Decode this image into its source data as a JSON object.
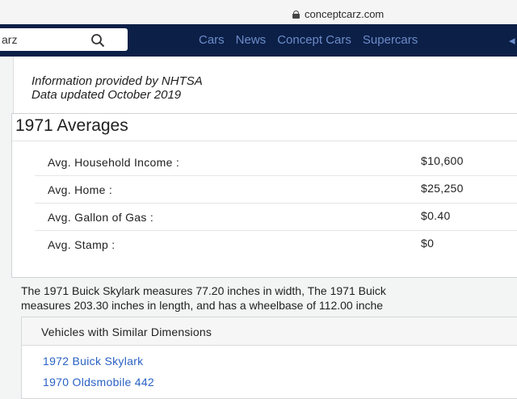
{
  "browser": {
    "url": "conceptcarz.com"
  },
  "nav": {
    "search_value": "arz",
    "links": [
      "Cars",
      "News",
      "Concept Cars",
      "Supercars"
    ],
    "more": "◂"
  },
  "info": {
    "line1": "Information provided by NHTSA",
    "line2": "Data updated October 2019"
  },
  "averages": {
    "title": "1971 Averages",
    "rows": [
      {
        "label": "Avg. Household Income :",
        "value": "$10,600"
      },
      {
        "label": "Avg. Home :",
        "value": "$25,250"
      },
      {
        "label": "Avg. Gallon of Gas :",
        "value": "$0.40"
      },
      {
        "label": "Avg. Stamp :",
        "value": "$0"
      }
    ]
  },
  "description": {
    "line1": "The 1971 Buick Skylark measures 77.20 inches in width, The 1971 Buick",
    "line2": "measures 203.30 inches in length, and has a wheelbase of 112.00 inche"
  },
  "similar": {
    "title": "Vehicles with Similar Dimensions",
    "links": [
      "1972 Buick Skylark",
      "1970 Oldsmobile 442"
    ]
  }
}
